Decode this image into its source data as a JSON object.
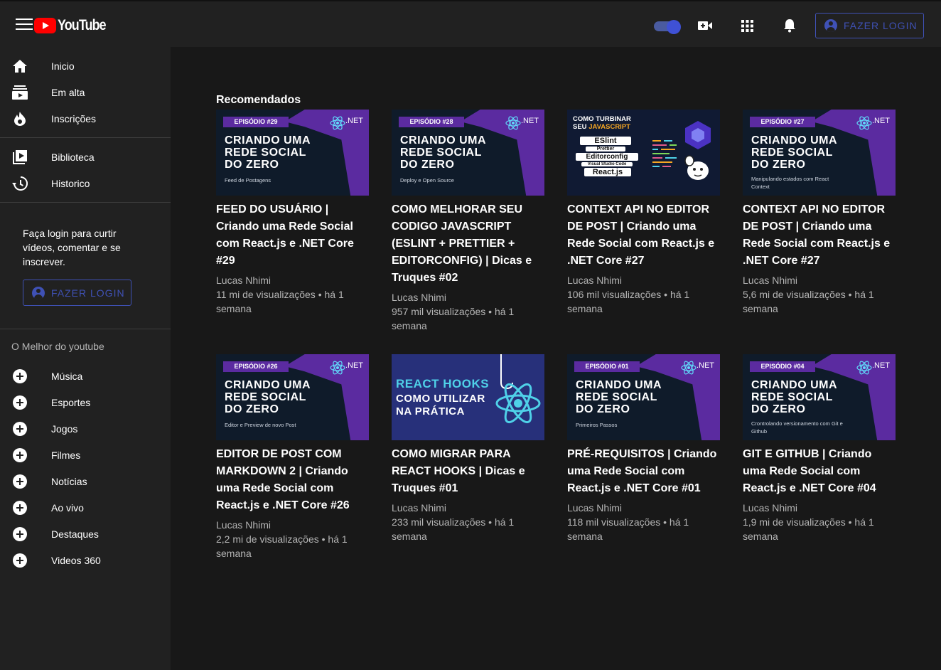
{
  "header": {
    "logo_text": "YouTube",
    "login_label": "FAZER LOGIN",
    "accent": "#3f51b5"
  },
  "sidebar": {
    "main_items": [
      {
        "label": "Inicio",
        "icon": "home-icon"
      },
      {
        "label": "Em alta",
        "icon": "trending-icon"
      },
      {
        "label": "Inscrições",
        "icon": "subscriptions-icon"
      }
    ],
    "library_items": [
      {
        "label": "Biblioteca",
        "icon": "library-icon"
      },
      {
        "label": "Historico",
        "icon": "history-icon"
      }
    ],
    "login_prompt": "Faça login para curtir vídeos, comentar e se inscrever.",
    "login_label": "FAZER LOGIN",
    "section_title": "O Melhor do youtube",
    "best_items": [
      {
        "label": "Música",
        "icon": "plus-icon"
      },
      {
        "label": "Esportes",
        "icon": "plus-icon"
      },
      {
        "label": "Jogos",
        "icon": "plus-icon"
      },
      {
        "label": "Filmes",
        "icon": "plus-icon"
      },
      {
        "label": "Notícias",
        "icon": "plus-icon"
      },
      {
        "label": "Ao vivo",
        "icon": "plus-icon"
      },
      {
        "label": "Destaques",
        "icon": "plus-icon"
      },
      {
        "label": "Videos 360",
        "icon": "plus-icon"
      }
    ]
  },
  "main": {
    "title": "Recomendados",
    "videos": [
      {
        "title": "FEED DO USUÁRIO | Criando uma Rede Social com React.js e .NET Core #29",
        "channel": "Lucas Nhimi",
        "meta": "11 mi de visualizações • há 1 semana",
        "thumb": {
          "badge": "EPISÓDIO #29",
          "heading": "CRIANDO UMA REDE SOCIAL DO ZERO",
          "sub": "Feed de Postagens",
          "net": ".NET"
        }
      },
      {
        "title": "COMO MELHORAR SEU CODIGO JAVASCRIPT (ESLINT + PRETTIER + EDITORCONFIG) | Dicas e Truques #02",
        "channel": "Lucas Nhimi",
        "meta": "957 mil visualizações • há 1 semana",
        "thumb": {
          "badge": "EPISÓDIO #28",
          "heading": "CRIANDO UMA REDE SOCIAL DO ZERO",
          "sub": "Deploy e Open Source",
          "net": ".NET"
        }
      },
      {
        "title": "CONTEXT API NO EDITOR DE POST | Criando uma Rede Social com React.js e .NET Core #27",
        "channel": "Lucas Nhimi",
        "meta": "106 mil visualizações • há 1 semana",
        "thumb": {
          "top1": "COMO TURBINAR",
          "top2a": "SEU ",
          "top2b": "JAVASCRIPT",
          "rows": [
            "ESlint",
            "Prettier",
            "Editorconfig",
            "Visual Studio Code",
            "React.js"
          ]
        }
      },
      {
        "title": "CONTEXT API NO EDITOR DE POST | Criando uma Rede Social com React.js e .NET Core #27",
        "channel": "Lucas Nhimi",
        "meta": "5,6 mi de visualizações • há 1 semana",
        "thumb": {
          "badge": "EPISÓDIO #27",
          "heading": "CRIANDO UMA REDE SOCIAL DO ZERO",
          "sub": "Manipulando estados com React Context",
          "net": ".NET"
        }
      },
      {
        "title": "EDITOR DE POST COM MARKDOWN 2 | Criando uma Rede Social com React.js e .NET Core #26",
        "channel": "Lucas Nhimi",
        "meta": "2,2 mi de visualizações • há 1 semana",
        "thumb": {
          "badge": "EPISÓDIO #26",
          "heading": "CRIANDO UMA REDE SOCIAL DO ZERO",
          "sub": "Editor e Preview de novo Post",
          "net": ".NET"
        }
      },
      {
        "title": "COMO MIGRAR PARA REACT HOOKS | Dicas e Truques #01",
        "channel": "Lucas Nhimi",
        "meta": "233 mil visualizações • há 1 semana",
        "thumb": {
          "line1": "REACT HOOKS",
          "line2": "COMO UTILIZAR",
          "line3": "NA PRÁTICA"
        }
      },
      {
        "title": "PRÉ-REQUISITOS | Criando uma Rede Social com React.js e .NET Core #01",
        "channel": "Lucas Nhimi",
        "meta": "118 mil visualizações • há 1 semana",
        "thumb": {
          "badge": "EPISÓDIO #01",
          "heading": "CRIANDO UMA REDE SOCIAL DO ZERO",
          "sub": "Primeiros Passos",
          "net": ".NET"
        }
      },
      {
        "title": "GIT E GITHUB | Criando uma Rede Social com React.js e .NET Core #04",
        "channel": "Lucas Nhimi",
        "meta": "1,9 mi de visualizações • há 1 semana",
        "thumb": {
          "badge": "EPISÓDIO #04",
          "heading": "CRIANDO UMA REDE SOCIAL DO ZERO",
          "sub": "Crontrolando versionamento com Git e Github",
          "net": ".NET"
        }
      }
    ]
  }
}
